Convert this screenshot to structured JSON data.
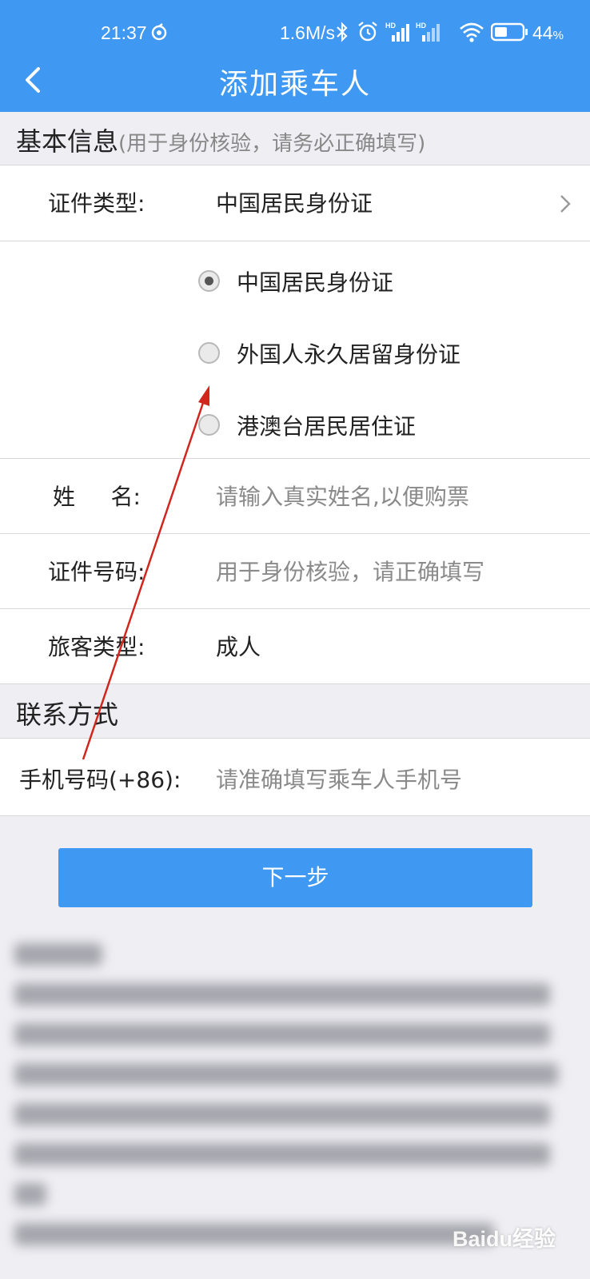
{
  "status_bar": {
    "time": "21:37",
    "speed": "1.6M/s",
    "battery": "44",
    "battery_unit": "%",
    "icons": [
      "sync-icon",
      "bluetooth-icon",
      "alarm-icon",
      "signal-hd-icon",
      "signal-hd-icon",
      "wifi-icon",
      "battery-icon"
    ]
  },
  "header": {
    "title": "添加乘车人",
    "background": "#3f98f2"
  },
  "basic_info": {
    "heading": "基本信息",
    "hint": "(用于身份核验，请务必正确填写)"
  },
  "id_type": {
    "label": "证件类型:",
    "value": "中国居民身份证",
    "options": [
      {
        "label": "中国居民身份证",
        "selected": true
      },
      {
        "label": "外国人永久居留身份证",
        "selected": false
      },
      {
        "label": "港澳台居民居住证",
        "selected": false
      }
    ]
  },
  "name": {
    "label": "姓     名:",
    "placeholder": "请输入真实姓名,以便购票"
  },
  "id_number": {
    "label": "证件号码:",
    "placeholder": "用于身份核验，请正确填写"
  },
  "passenger_type": {
    "label": "旅客类型:",
    "value": "成人"
  },
  "contact": {
    "heading": "联系方式",
    "phone_label": "手机号码(+86):",
    "phone_placeholder": "请准确填写乘车人手机号"
  },
  "next_button": {
    "label": "下一步"
  },
  "watermark": "Baidu经验"
}
